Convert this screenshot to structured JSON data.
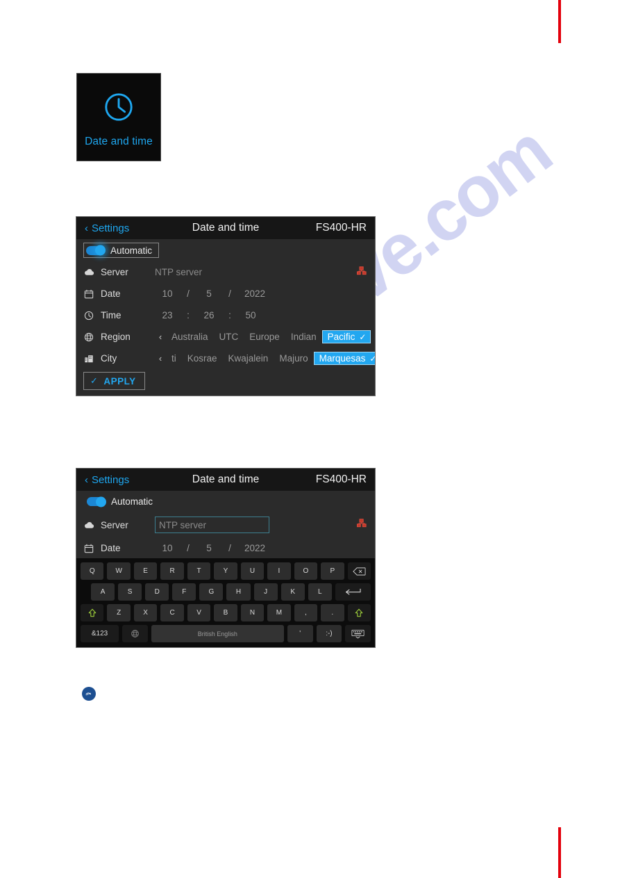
{
  "page": {
    "watermark_text": "alshive.com",
    "edge_mark_color": "#e3000b"
  },
  "app_tile": {
    "label": "Date and time",
    "icon": "clock-icon",
    "accent": "#1ea7f0"
  },
  "panel_settings": {
    "header": {
      "back_label": "Settings",
      "title": "Date and time",
      "device": "FS400-HR"
    },
    "automatic": {
      "label": "Automatic",
      "state": "on"
    },
    "server": {
      "label": "Server",
      "value": "NTP server",
      "icon": "cloud-icon",
      "status_icon": "network-error-icon"
    },
    "date": {
      "label": "Date",
      "icon": "calendar-icon",
      "day": "10",
      "sep1": "/",
      "month": "5",
      "sep2": "/",
      "year": "2022"
    },
    "time": {
      "label": "Time",
      "icon": "clock-icon",
      "hours": "23",
      "sep1": ":",
      "minutes": "26",
      "sep2": ":",
      "seconds": "50"
    },
    "region": {
      "label": "Region",
      "icon": "globe-icon",
      "prev_arrow": "‹",
      "next_arrow": "›",
      "options": [
        "Australia",
        "UTC",
        "Europe",
        "Indian"
      ],
      "selected": "Pacific",
      "selected_tick": "✓"
    },
    "city": {
      "label": "City",
      "icon": "city-icon",
      "prev_arrow": "‹",
      "next_arrow": "›",
      "options": [
        "ti",
        "Kosrae",
        "Kwajalein",
        "Majuro"
      ],
      "selected": "Marquesas",
      "selected_tick": "✓"
    },
    "apply": {
      "label": "APPLY",
      "tick": "✓"
    }
  },
  "panel_keyboard": {
    "header": {
      "back_label": "Settings",
      "title": "Date and time",
      "device": "FS400-HR"
    },
    "automatic": {
      "label": "Automatic",
      "state": "on"
    },
    "server": {
      "label": "Server",
      "placeholder": "NTP server",
      "value": "",
      "icon": "cloud-icon",
      "status_icon": "network-error-icon"
    },
    "date": {
      "label": "Date",
      "icon": "calendar-icon",
      "day": "10",
      "sep1": "/",
      "month": "5",
      "sep2": "/",
      "year": "2022"
    },
    "keyboard": {
      "layout_label": "British English",
      "row1": [
        "Q",
        "W",
        "E",
        "R",
        "T",
        "Y",
        "U",
        "I",
        "O",
        "P"
      ],
      "row1_action": "backspace-key",
      "row2": [
        "A",
        "S",
        "D",
        "F",
        "G",
        "H",
        "J",
        "K",
        "L"
      ],
      "row2_action": "enter-key",
      "row3_shift_left": "shift-key",
      "row3": [
        "Z",
        "X",
        "C",
        "V",
        "B",
        "N",
        "M",
        ",",
        "."
      ],
      "row3_shift_right": "shift-key",
      "row4_symbols": "&123",
      "row4_globe": "language-key",
      "row4_space": "British English",
      "row4_apostrophe": "'",
      "row4_emoji": ":-)",
      "row4_hide": "hide-keyboard-key"
    }
  },
  "note": {
    "icon": "pointing-hand-icon"
  }
}
